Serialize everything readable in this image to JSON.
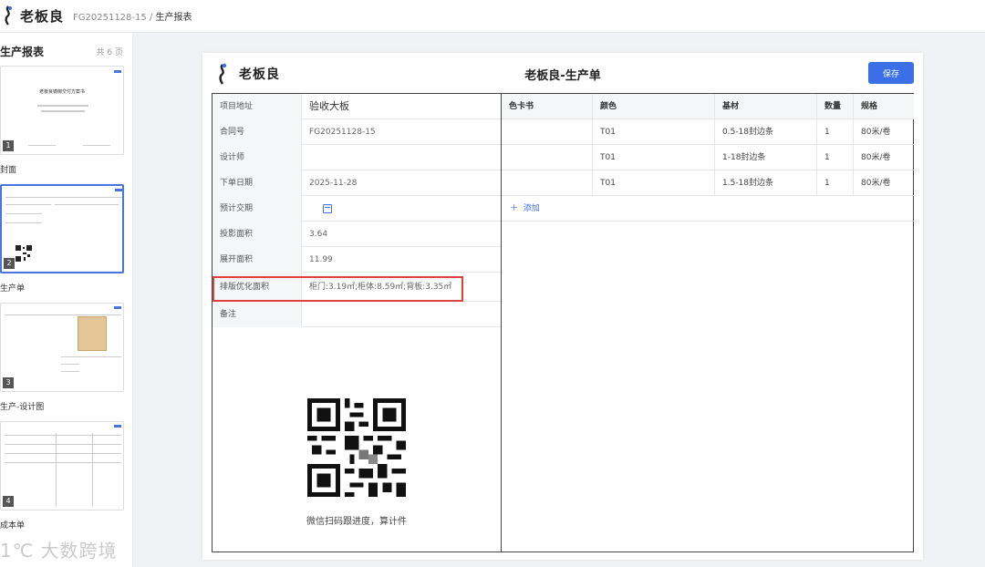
{
  "header": {
    "logo_text": "老板良",
    "breadcrumb_id": "FG20251128-15",
    "breadcrumb_sep": " / ",
    "breadcrumb_page": "生产报表"
  },
  "sidebar": {
    "title": "生产报表",
    "count": "共 6 页",
    "thumbs": [
      {
        "num": "1",
        "caption": "封面",
        "title": "老板良铸御交付方案书"
      },
      {
        "num": "2",
        "caption": "生产单"
      },
      {
        "num": "3",
        "caption": "生产-设计图"
      },
      {
        "num": "4",
        "caption": "成本单"
      }
    ]
  },
  "watermark": "1℃ 大数跨境",
  "doc": {
    "brand": "老板良",
    "title": "老板良-生产单",
    "save_label": "保存",
    "info": [
      {
        "label": "项目地址",
        "value": "验收大板"
      },
      {
        "label": "合同号",
        "value": "FG20251128-15"
      },
      {
        "label": "设计师",
        "value": ""
      },
      {
        "label": "下单日期",
        "value": "2025-11-28"
      },
      {
        "label": "预计交期",
        "value": ""
      },
      {
        "label": "投影面积",
        "value": "3.64"
      },
      {
        "label": "展开面积",
        "value": "11.99"
      },
      {
        "label": "排版优化面积",
        "value": "柜门:3.19㎡;柜体:8.59㎡;背板:3.35㎡"
      },
      {
        "label": "备注",
        "value": ""
      }
    ],
    "qr_caption": "微信扫码跟进度，算计件",
    "table": {
      "headers": [
        "色卡书",
        "颜色",
        "基材",
        "数量",
        "规格"
      ],
      "rows": [
        [
          "",
          "T01",
          "0.5-18封边条",
          "1",
          "80米/卷"
        ],
        [
          "",
          "T01",
          "1-18封边条",
          "1",
          "80米/卷"
        ],
        [
          "",
          "T01",
          "1.5-18封边条",
          "1",
          "80米/卷"
        ]
      ],
      "add_label": "添加"
    }
  },
  "colors": {
    "accent": "#3a6fe8",
    "highlight": "#e04040"
  }
}
